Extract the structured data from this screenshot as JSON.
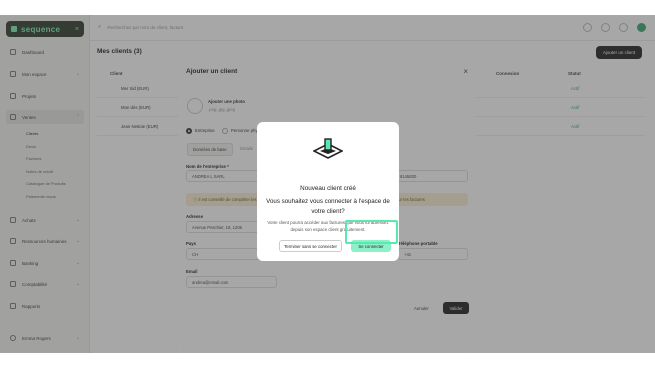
{
  "brand": {
    "name": "sequence",
    "close": "×"
  },
  "sidebar": {
    "items": [
      {
        "label": "Dashboard",
        "chev": ""
      },
      {
        "label": "Mon espace",
        "chev": "⌄"
      },
      {
        "label": "Projets",
        "chev": ""
      },
      {
        "label": "Ventes",
        "chev": "⌃"
      },
      {
        "label": "Achats",
        "chev": "⌄"
      },
      {
        "label": "Ressources humaines",
        "chev": "⌄"
      },
      {
        "label": "Banking",
        "chev": "⌄"
      },
      {
        "label": "Comptabilité",
        "chev": "⌄"
      },
      {
        "label": "Rapports",
        "chev": ""
      },
      {
        "label": "Emma Rogers",
        "chev": "⌄"
      }
    ],
    "sub_items": [
      "Clients",
      "Devis",
      "Factures",
      "Notes de crédit",
      "Catalogue de Produits",
      "Paiements reçus"
    ]
  },
  "topbar": {
    "search_placeholder": "Recherchez par nom de client, facture"
  },
  "page": {
    "title": "Mes clients (3)",
    "add_button": "Ajouter un client"
  },
  "table": {
    "headers": [
      "Client",
      "Connexion",
      "Statut"
    ],
    "rows": [
      {
        "name": "Mer Sid (EUR)",
        "status": "Actif"
      },
      {
        "name": "Mon dés (EUR)",
        "status": "Actif"
      },
      {
        "name": "Jean Nettoie (EUR)",
        "status": "Actif"
      }
    ]
  },
  "client_modal": {
    "title": "Ajouter un client",
    "close": "×",
    "photo_title": "Ajouter une photo",
    "photo_sub": ".png,.jpg,.jpeg",
    "type_company": "Entreprise",
    "type_person": "Personne physique",
    "tab_active": "Données de base",
    "tab_other": "Détails",
    "company_label": "Nom de l'entreprise *",
    "company_value": "ANDREA L SARL",
    "field_right_value": "6145830",
    "warning": "Il est conseillé de compléter les informations Siren/Siret pour éviter les erreurs d'identification du client. Off sur les factures",
    "address_label": "Adresse",
    "address_value": "Avenue Peschier, 18, 1206",
    "country_label": "Pays",
    "country_value": "CH",
    "phone_label": "Téléphone portable",
    "phone_value": "+41",
    "email_label": "Email",
    "email_value": "andrea@email.com",
    "cancel": "Annuler",
    "submit": "Valider"
  },
  "confirm": {
    "title": "Nouveau client créé",
    "question": "Vous souhaitez vous connecter à l'espace de votre client?",
    "description": "Votre client pourra accéder aux factures que vous lui adressez depuis son espace client gratuitement.",
    "secondary_button": "Terminer sans se connecter",
    "primary_button": "Se connecter"
  },
  "colors": {
    "accent": "#8ef0c8",
    "highlight": "#58e8b0",
    "brand_bg": "#2f3d2f",
    "brand_fg": "#7ef0b5",
    "status": "#3aa76d",
    "connexion": "#e2574c"
  }
}
